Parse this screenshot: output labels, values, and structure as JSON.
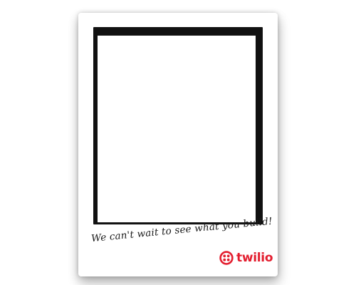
{
  "card": {
    "tagline": "We can't wait to see what you build!",
    "brand": {
      "name": "twilio",
      "color": "#e31e2f",
      "icon": "twilio-logo-icon"
    }
  },
  "colors": {
    "frame": "#111111",
    "photo": "#ffffff",
    "card": "#ffffff"
  }
}
